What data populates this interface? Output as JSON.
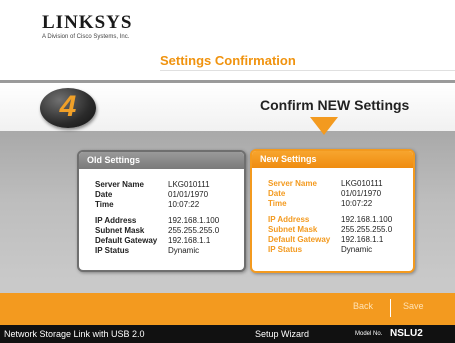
{
  "brand": {
    "logo": "LINKSYS",
    "tagline": "A Division of Cisco Systems, Inc."
  },
  "page_heading": "Settings Confirmation",
  "step": {
    "number": "4",
    "title": "Confirm NEW Settings"
  },
  "old_settings": {
    "title": "Old Settings",
    "rows": [
      {
        "label": "Server Name",
        "value": "LKG010111"
      },
      {
        "label": "Date",
        "value": "01/01/1970"
      },
      {
        "label": "Time",
        "value": "10:07:22"
      },
      {
        "label": "IP Address",
        "value": "192.168.1.100"
      },
      {
        "label": "Subnet Mask",
        "value": "255.255.255.0"
      },
      {
        "label": "Default Gateway",
        "value": "192.168.1.1"
      },
      {
        "label": "IP Status",
        "value": "Dynamic"
      }
    ]
  },
  "new_settings": {
    "title": "New Settings",
    "rows": [
      {
        "label": "Server Name",
        "value": "LKG010111"
      },
      {
        "label": "Date",
        "value": "01/01/1970"
      },
      {
        "label": "Time",
        "value": "10:07:22"
      },
      {
        "label": "IP Address",
        "value": "192.168.1.100"
      },
      {
        "label": "Subnet Mask",
        "value": "255.255.255.0"
      },
      {
        "label": "Default Gateway",
        "value": "192.168.1.1"
      },
      {
        "label": "IP Status",
        "value": "Dynamic"
      }
    ]
  },
  "buttons": {
    "back": "Back",
    "save": "Save"
  },
  "footer": {
    "product": "Network Storage Link with USB 2.0",
    "wizard": "Setup Wizard",
    "model_label": "Model No.",
    "model": "NSLU2"
  },
  "colors": {
    "accent": "#f39a1f",
    "footer": "#111111",
    "old_panel": "#7a7a7a"
  }
}
